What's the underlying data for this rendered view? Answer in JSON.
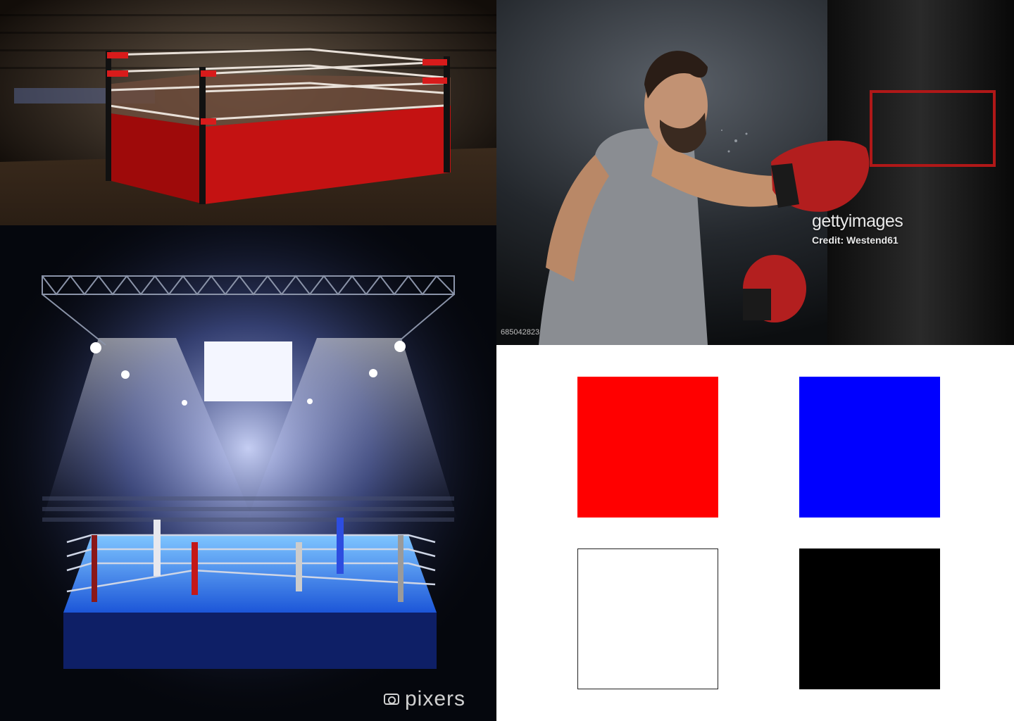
{
  "panels": {
    "ring_photo": {
      "subject": "boxing-ring-red-skirt"
    },
    "boxer_photo": {
      "watermark_brand": "gettyimages",
      "watermark_credit": "Credit: Westend61",
      "image_id": "685042823"
    },
    "arena_photo": {
      "watermark_brand": "pixers"
    }
  },
  "palette": {
    "swatches": [
      {
        "name": "red",
        "color": "#ff0000"
      },
      {
        "name": "blue",
        "color": "#0000ff"
      },
      {
        "name": "white",
        "color": "#ffffff"
      },
      {
        "name": "black",
        "color": "#000000"
      }
    ]
  }
}
